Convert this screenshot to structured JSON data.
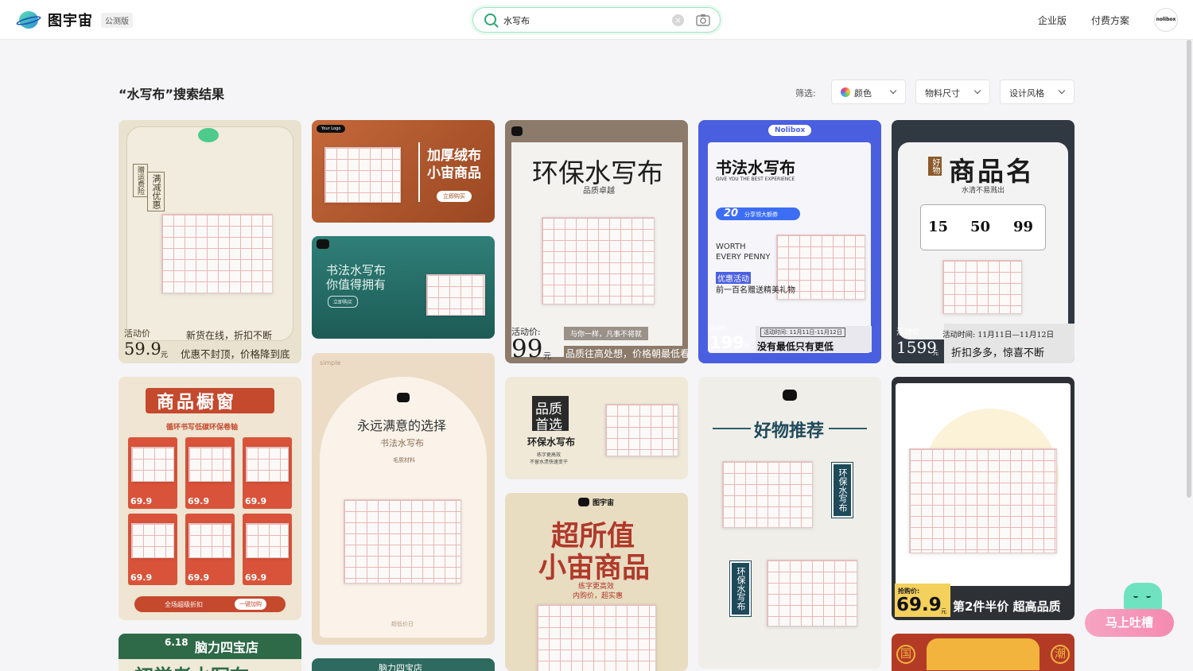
{
  "header": {
    "logo_text": "图宇宙",
    "beta_badge": "公测版",
    "search_value": "水写布",
    "nav_enterprise": "企业版",
    "nav_pricing": "付费方案",
    "avatar_text": "nolibox"
  },
  "results": {
    "title": "“水写布”搜索结果",
    "filter_label": "筛选:",
    "filters": {
      "color": "颜色",
      "size": "物料尺寸",
      "style": "设计风格"
    }
  },
  "cards": {
    "c1": {
      "side_a": "满减优惠",
      "side_b": "赠运费险",
      "price_label": "活动价",
      "price": "59.9",
      "unit": "元",
      "line1": "新货在线，折扣不断",
      "line2": "优惠不封顶，价格降到底"
    },
    "c2": {
      "brand": "Your Logo",
      "title1": "加厚绒布",
      "title2": "小宙商品",
      "button": "立即购买"
    },
    "c3": {
      "title1": "书法水写布",
      "title2": "你值得拥有",
      "button": "立即购买"
    },
    "c4": {
      "title": "环保水写布",
      "subtitle": "品质卓越",
      "price_label": "活动价:",
      "price": "99",
      "unit": "元",
      "tagline": "与你一样，凡事不将就",
      "footer": "品质往高处想，价格朝最低看"
    },
    "c5": {
      "brand": "Nolibox",
      "title": "书法水写布",
      "subtitle": "GIVE YOU THE BEST EXPERIENCE",
      "coupon": "20",
      "coupon_text": "分享领大额券",
      "worth1": "WORTH",
      "worth2": "EVERY PENNY",
      "promo_tag": "优惠活动",
      "promo_text": "前一百名赠送精美礼物",
      "price_label": "活动价",
      "price": "199",
      "unit": "元",
      "date": "活动时间: 11月11日-11月12日",
      "slogan": "没有最低只有更低"
    },
    "c6": {
      "badge": "好物",
      "title": "商品名",
      "subtitle": "水清不易溅出",
      "coupons": [
        "15",
        "50",
        "99"
      ],
      "price_label": "活动价",
      "price": "1599",
      "unit": "元",
      "date": "活动时间: 11月11日—11月12日",
      "slogan": "折扣多多，惊喜不断"
    },
    "c7": {
      "title": "商品橱窗",
      "subtitle": "循环书写低碳环保卷轴",
      "prices": [
        "69.9",
        "69.9",
        "69.9",
        "69.9",
        "69.9",
        "69.9"
      ],
      "footer": "全场超级折扣",
      "cart": "一键加购"
    },
    "c8": {
      "brand": "simple",
      "title": "永远满意的选择",
      "subtitle": "书法水写布",
      "material": "毛质材料",
      "footer": "超低价日"
    },
    "c9": {
      "badge1": "品质",
      "badge2": "首选",
      "title": "环保水写布",
      "line1": "练字更高效",
      "line2": "不留水渍快速变干"
    },
    "c10": {
      "brand": "图宇宙",
      "title1": "超所值",
      "title2": "小宙商品",
      "line1": "练字更高效",
      "line2": "内购价，超实惠"
    },
    "c11": {
      "title": "好物推荐",
      "vert1": "环保水写布",
      "vert2": "环保水写布"
    },
    "c12": {
      "price_label": "抢购价:",
      "price": "69.9",
      "unit": "元",
      "slogan": "第2件半价 超高品质"
    },
    "c13": {
      "date": "6.18",
      "store": "脑力四宝店",
      "title": "初学者水写布"
    },
    "c14": {
      "store": "脑力四宝店"
    },
    "c15": {
      "left": "国",
      "right": "潮"
    }
  },
  "floating": {
    "label": "马上吐槽"
  },
  "colors": {
    "accent": "#2aa876",
    "brand_blue": "#4a5fe0",
    "pink": "#f58ab0"
  }
}
